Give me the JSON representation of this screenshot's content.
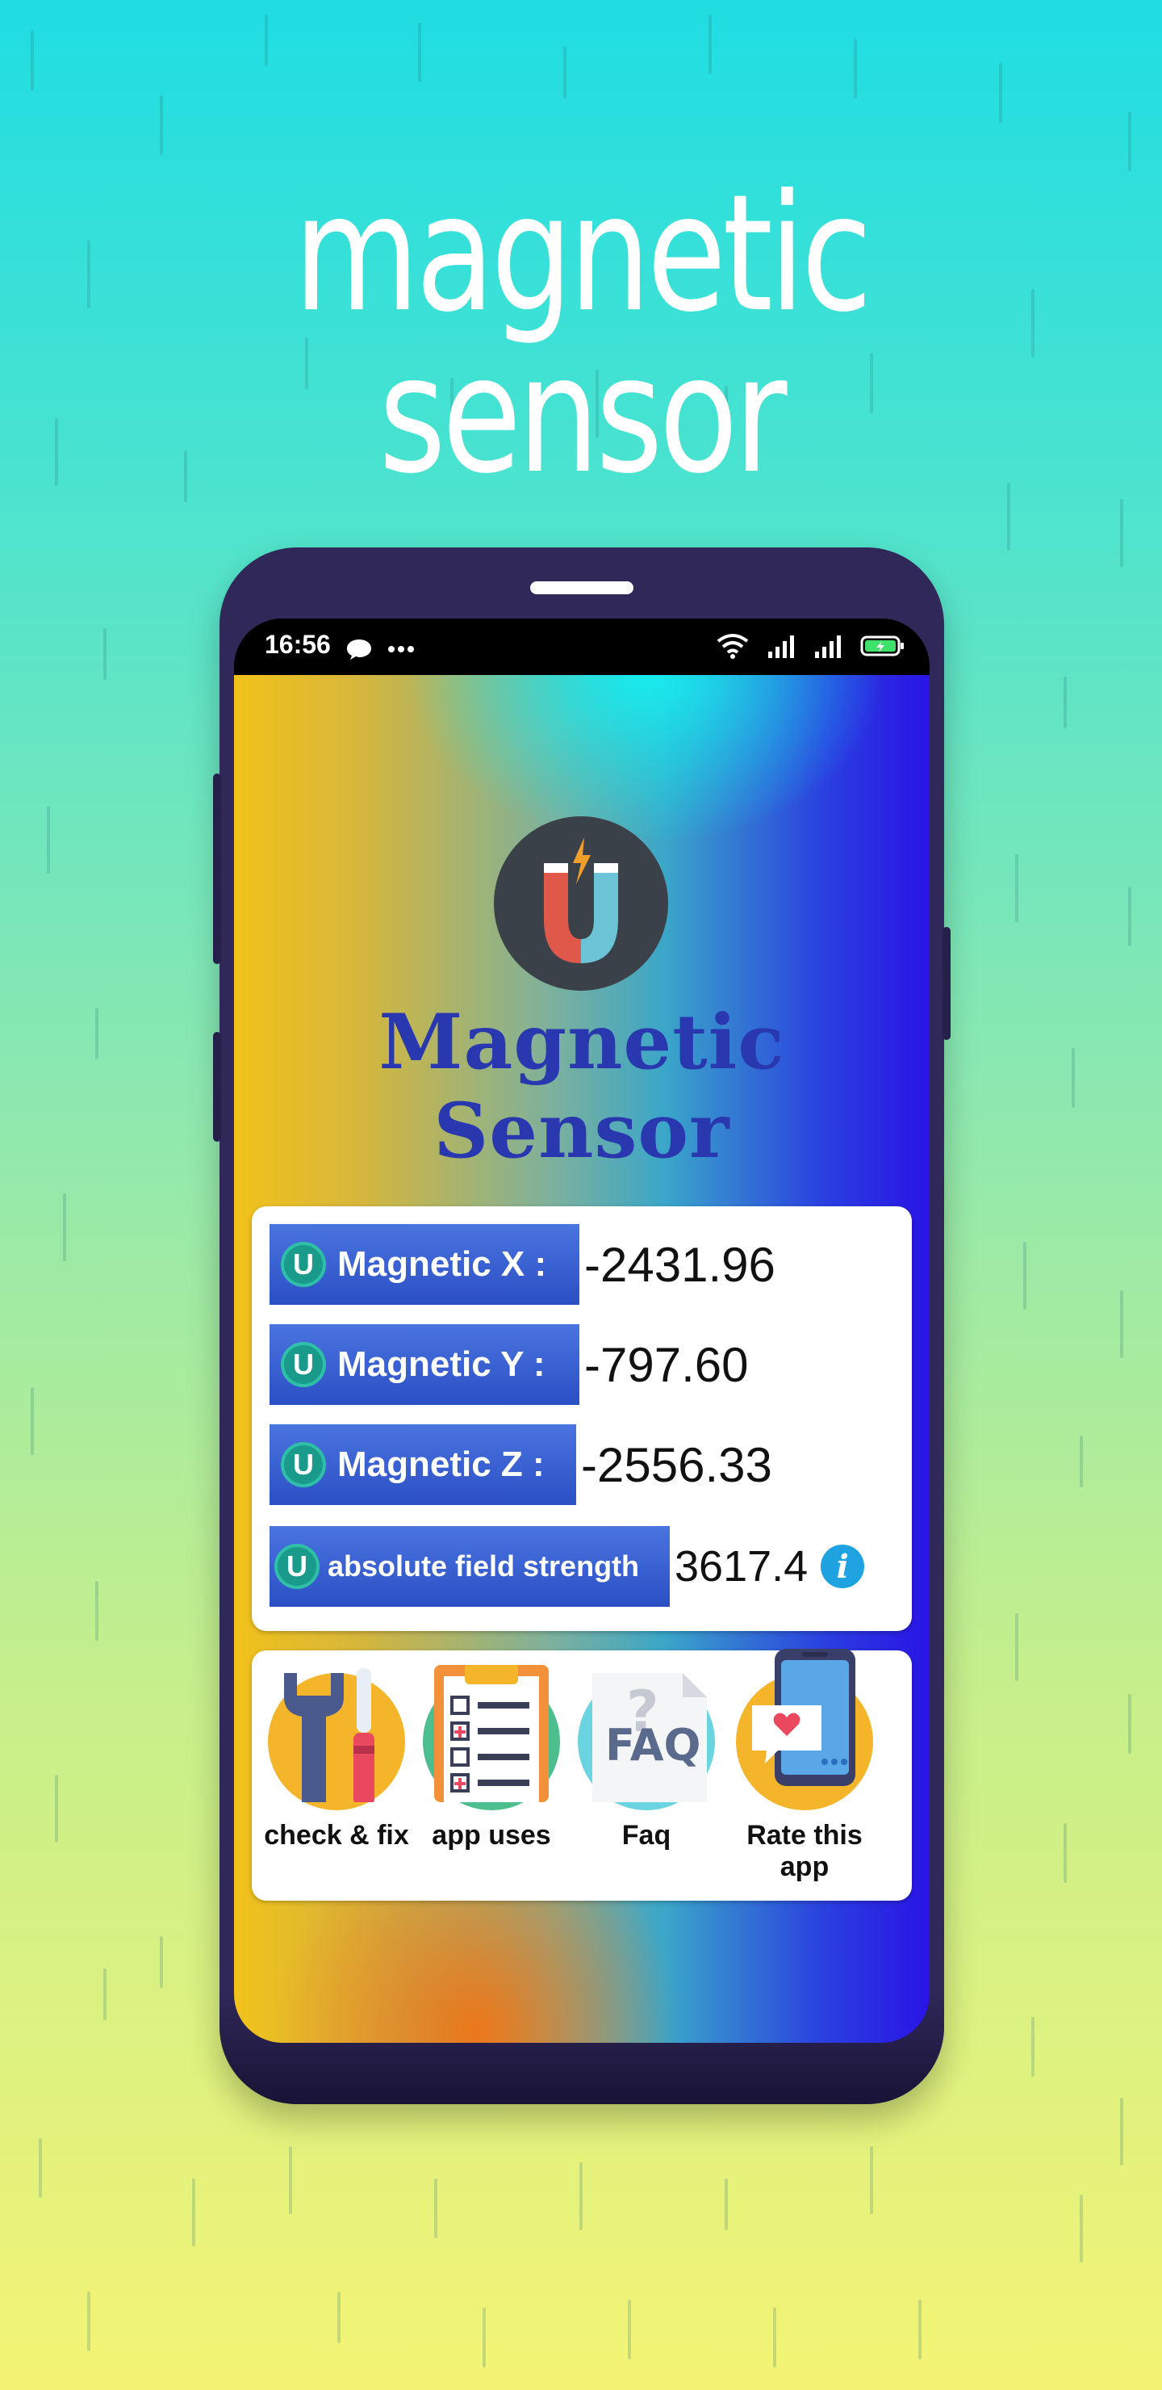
{
  "headline": "magnetic sensor",
  "status_bar": {
    "time": "16:56",
    "icons": [
      "chat-bubble-icon",
      "more-dots-icon",
      "wifi-icon",
      "signal-icon",
      "signal-icon",
      "battery-charging-icon"
    ]
  },
  "app": {
    "title": "Magnetic Sensor",
    "logo_icon": "magnet-icon"
  },
  "readings": [
    {
      "label": "Magnetic X :",
      "value": "-2431.96"
    },
    {
      "label": "Magnetic Y :",
      "value": "-797.60"
    },
    {
      "label": "Magnetic Z :",
      "value": "-2556.33"
    },
    {
      "label": "absolute field strength",
      "value": "3617.4"
    }
  ],
  "nav": [
    {
      "label": "check & fix",
      "icon": "tools-icon"
    },
    {
      "label": "app uses",
      "icon": "checklist-icon"
    },
    {
      "label": "Faq",
      "icon": "faq-icon"
    },
    {
      "label": "Rate this app",
      "icon": "rate-phone-icon"
    }
  ],
  "colors": {
    "label_blue": "#2b4fc4",
    "title_blue": "#2a38b0",
    "badge_teal": "#1a9a8a",
    "info_blue": "#1fa3e0"
  }
}
